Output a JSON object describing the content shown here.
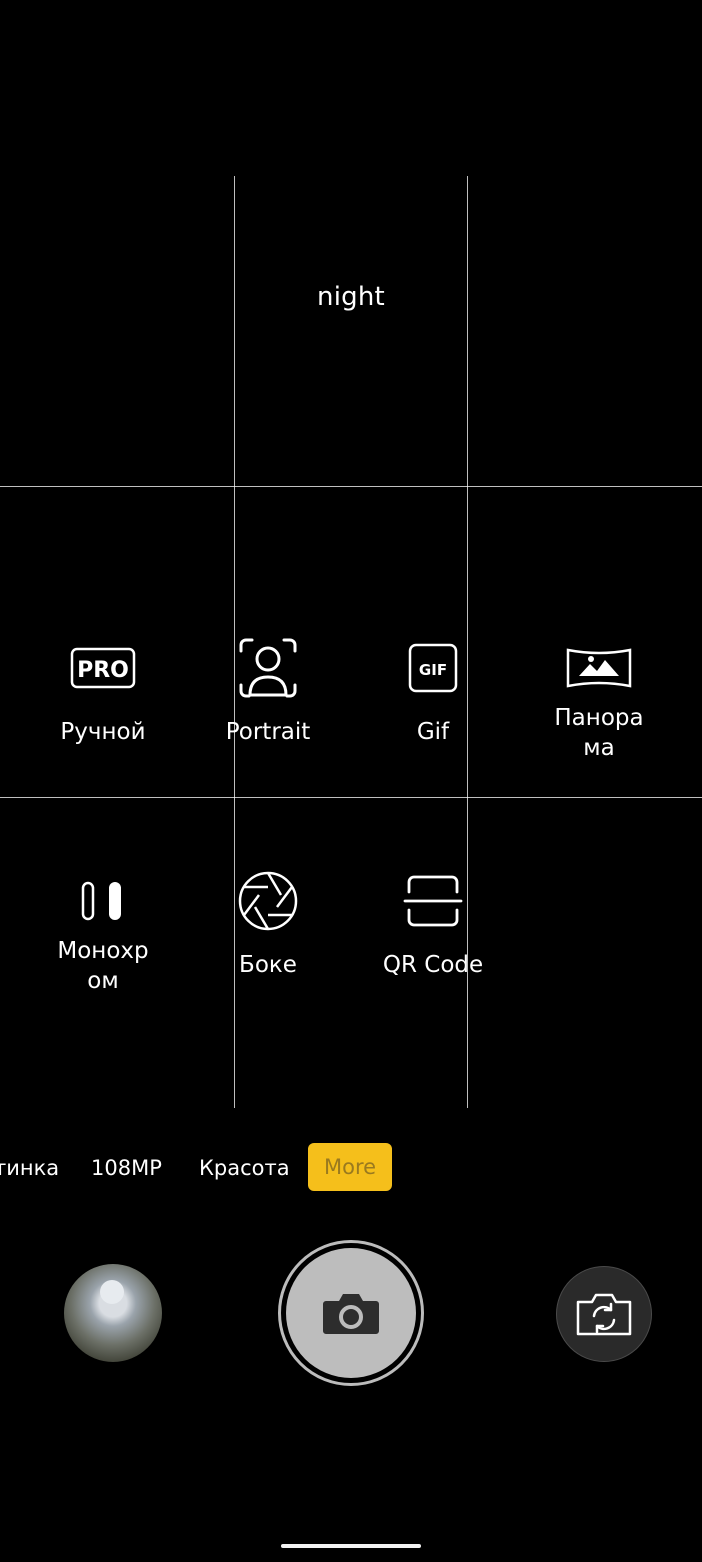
{
  "scene": {
    "label": "night"
  },
  "modes": [
    {
      "label": "Ручной",
      "icon": "pro-icon"
    },
    {
      "label": "Portrait",
      "icon": "portrait-icon"
    },
    {
      "label": "Gif",
      "icon": "gif-icon"
    },
    {
      "label": "Панора\nма",
      "icon": "panorama-icon"
    },
    {
      "label": "Монохр\nом",
      "icon": "monochrome-icon"
    },
    {
      "label": "Боке",
      "icon": "aperture-icon"
    },
    {
      "label": "QR Code",
      "icon": "qr-scan-icon"
    }
  ],
  "icons": {
    "pro_text": "PRO",
    "gif_text": "GIF"
  },
  "mode_strip": {
    "items": [
      "тинка",
      "108MP",
      "Красота"
    ],
    "selected": "More",
    "selected_color": "#f5bf1b"
  },
  "controls": {
    "gallery_icon": "gallery-thumbnail",
    "shutter_icon": "camera-icon",
    "switch_icon": "switch-camera-icon"
  }
}
